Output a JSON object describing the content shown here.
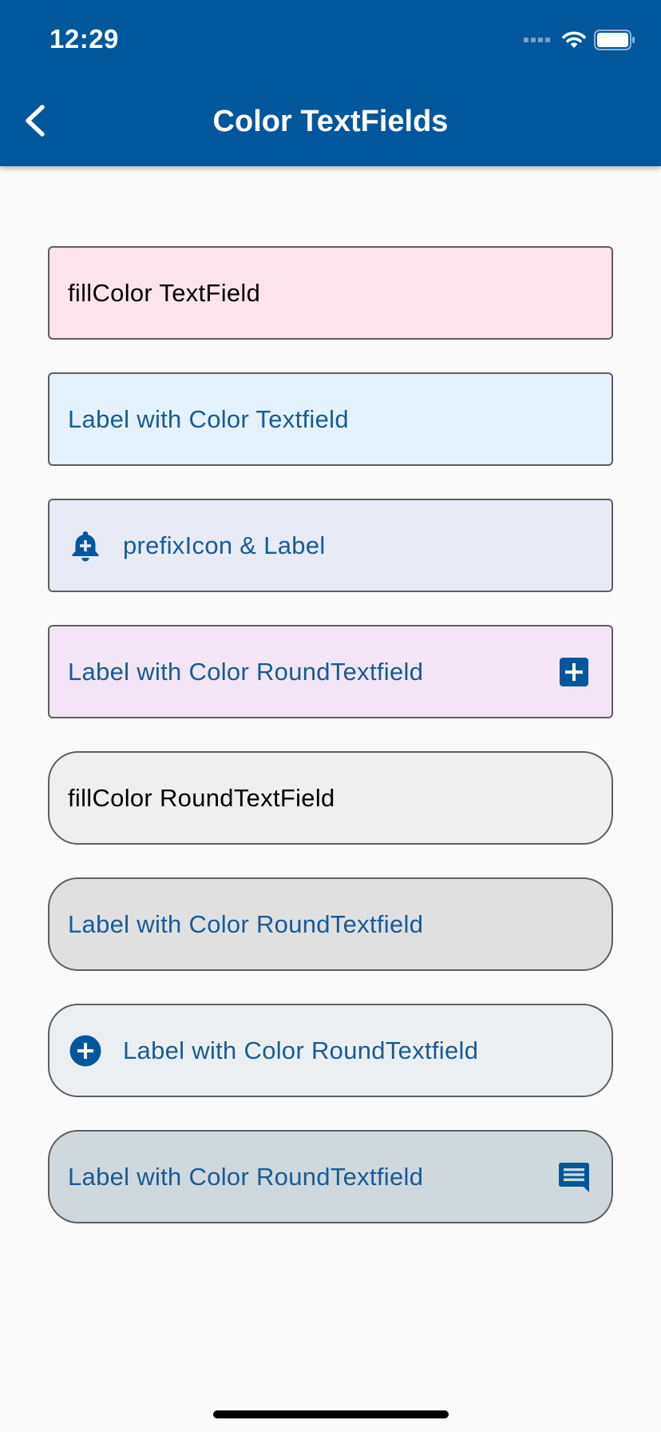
{
  "status_bar": {
    "time": "12:29",
    "icons": [
      "signal-icon",
      "wifi-icon",
      "battery-icon"
    ]
  },
  "app_bar": {
    "title": "Color TextFields",
    "back_icon": "chevron-left-icon",
    "background": "#01579b"
  },
  "colors": {
    "accent": "#185b95",
    "border": "#5e5e5e"
  },
  "fields": [
    {
      "text": "fillColor TextField",
      "shape": "rect",
      "fill": "#fce4ec"
    },
    {
      "text": "Label with Color Textfield",
      "shape": "rect",
      "fill": "#e3f2fd"
    },
    {
      "text": "prefixIcon & Label",
      "shape": "rect",
      "fill": "#e8eaf6",
      "prefix_icon": "add-alert-bell-icon"
    },
    {
      "text": "Label with Color RoundTextfield",
      "shape": "rect",
      "fill": "#f3e5f5",
      "suffix_icon": "add-box-icon"
    },
    {
      "text": "fillColor RoundTextField",
      "shape": "round",
      "fill": "#efefef"
    },
    {
      "text": "Label with Color RoundTextfield",
      "shape": "round",
      "fill": "#e0e0e0"
    },
    {
      "text": "Label with Color RoundTextfield",
      "shape": "round",
      "fill": "#eceff1",
      "prefix_icon": "add-circle-icon"
    },
    {
      "text": "Label with Color RoundTextfield",
      "shape": "round",
      "fill": "#cfd8dc",
      "suffix_icon": "message-icon"
    }
  ]
}
